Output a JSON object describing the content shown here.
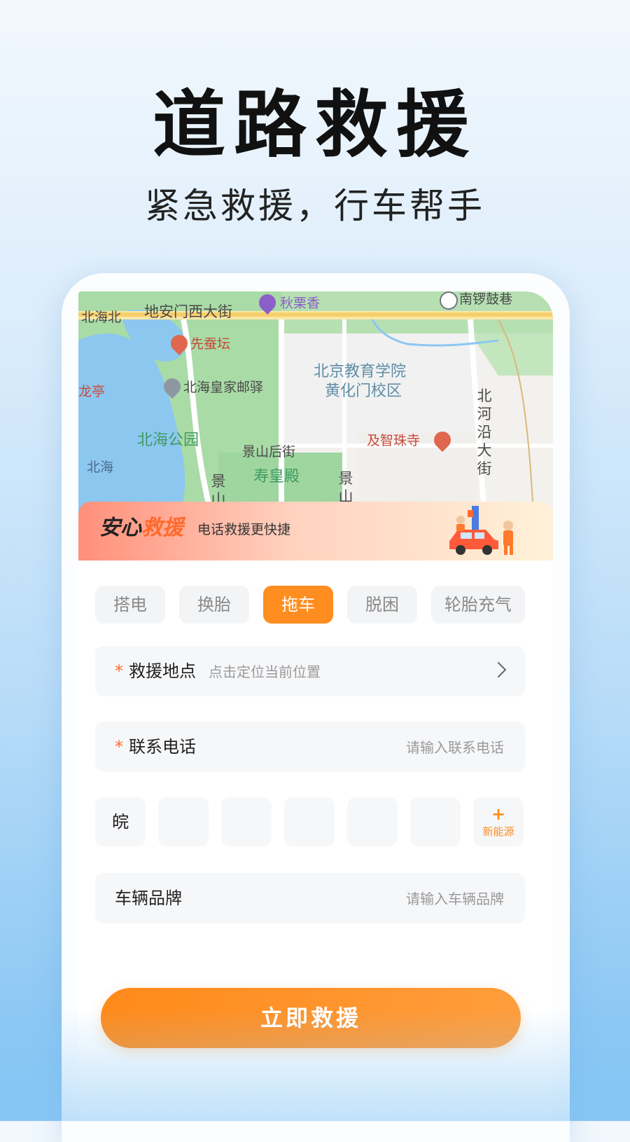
{
  "hero": {
    "title": "道路救援",
    "subtitle": "紧急救援，行车帮手"
  },
  "map": {
    "labels": {
      "beihai_north": "北海北",
      "dianmen_west": "地安门西大街",
      "qiulixiang": "秋栗香",
      "nanluogu": "南锣鼓巷",
      "xiancantan": "先蚕坛",
      "college": "北京教育学院",
      "college_campus": "黄化门校区",
      "longting": "龙亭",
      "beihai_post": "北海皇家邮驿",
      "beiheyan": "北河沿大街",
      "beihai_park": "北海公园",
      "jingshan_back": "景山后街",
      "jizhuzhu": "及智珠寺",
      "beihai": "北海",
      "shouhuang": "寿皇殿",
      "jing_left": "景山",
      "jing_right": "景山"
    }
  },
  "banner": {
    "title_part1": "安心",
    "title_part2": "救援",
    "subtitle": "电话救援更快捷"
  },
  "service_tabs": [
    {
      "label": "搭电",
      "active": false
    },
    {
      "label": "换胎",
      "active": false
    },
    {
      "label": "拖车",
      "active": true
    },
    {
      "label": "脱困",
      "active": false
    },
    {
      "label": "轮胎充气",
      "active": false
    }
  ],
  "form": {
    "location": {
      "required_mark": "*",
      "label": "救援地点",
      "hint": "点击定位当前位置"
    },
    "phone": {
      "required_mark": "*",
      "label": "联系电话",
      "placeholder": "请输入联系电话"
    },
    "plate": {
      "province": "皖",
      "new_energy_plus": "+",
      "new_energy_label": "新能源"
    },
    "brand": {
      "label": "车辆品牌",
      "placeholder": "请输入车辆品牌"
    }
  },
  "cta": {
    "label": "立即救援"
  },
  "colors": {
    "accent": "#ff8d1f",
    "required": "#ff6a2c"
  }
}
